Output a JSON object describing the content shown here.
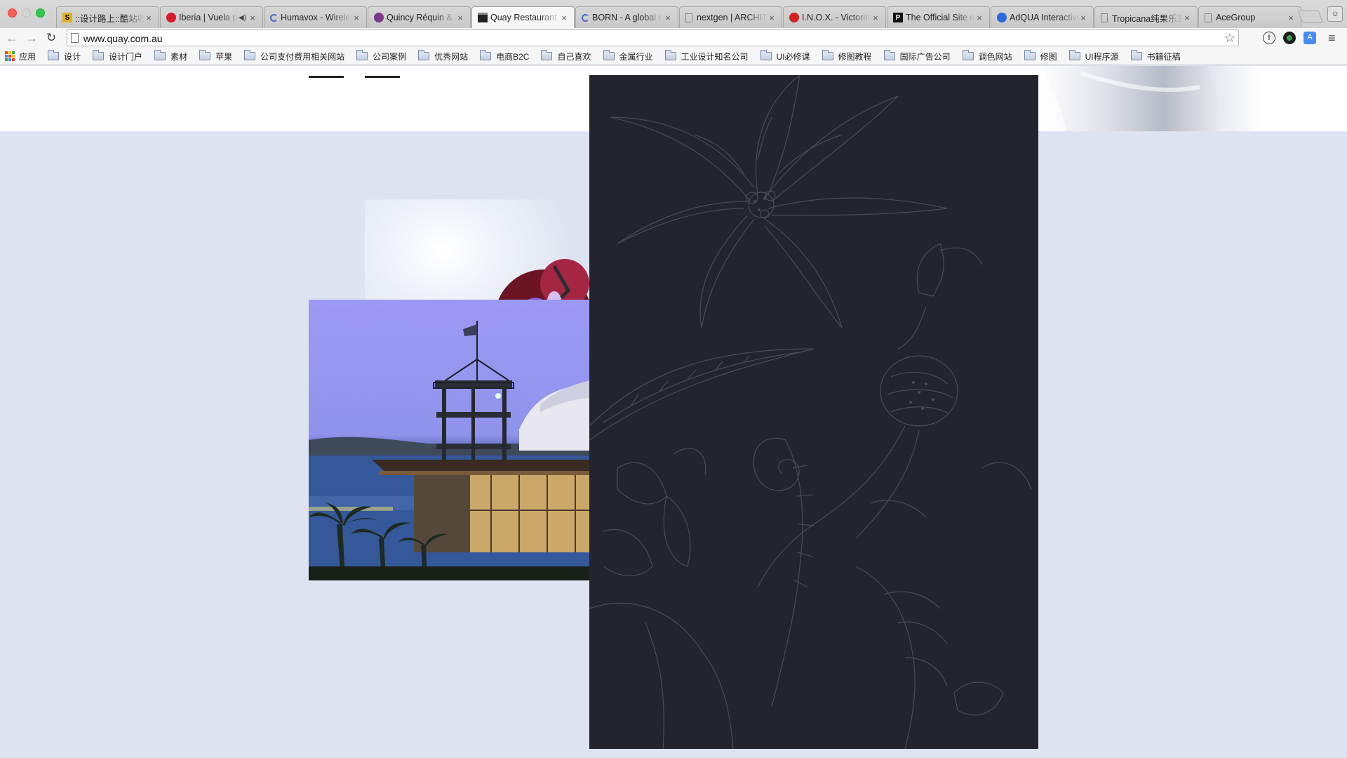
{
  "browser": {
    "tabs": [
      {
        "title": "::设计路上::酷站收藏",
        "favicon": "square-logo-icon",
        "favicon_color": "#e0b020",
        "active": false
      },
      {
        "title": "Iberia | Vuela por el mundo",
        "favicon": "iberia-icon",
        "favicon_color": "#d7192d",
        "active": false,
        "audio": true
      },
      {
        "title": "Humavox - Wireless Charging",
        "favicon": "loading-spinner-icon",
        "favicon_color": "#4a6ac8",
        "active": false
      },
      {
        "title": "Quincy Réquin & Associés",
        "favicon": "spiral-icon",
        "favicon_color": "#7a3a8a",
        "active": false
      },
      {
        "title": "Quay Restaurant",
        "favicon": "quay-icon",
        "favicon_color": "#222222",
        "active": true
      },
      {
        "title": "BORN - A global creative",
        "favicon": "loading-spinner-icon",
        "favicon_color": "#4a6ac8",
        "active": false
      },
      {
        "title": "nextgen | ARCHITECTURE",
        "favicon": "page-icon",
        "favicon_color": "#888888",
        "active": false
      },
      {
        "title": "I.N.O.X. - Victorinox",
        "favicon": "swiss-shield-icon",
        "favicon_color": "#d42020",
        "active": false
      },
      {
        "title": "The Official Site of",
        "favicon": "p-logo-icon",
        "favicon_color": "#111111",
        "active": false
      },
      {
        "title": "AdQUA Interactive",
        "favicon": "adqua-icon",
        "favicon_color": "#2a6ad8",
        "active": false
      },
      {
        "title": "Tropicana纯果乐官网",
        "favicon": "page-icon",
        "favicon_color": "#888888",
        "active": false
      },
      {
        "title": "AceGroup",
        "favicon": "page-icon",
        "favicon_color": "#888888",
        "active": false
      }
    ],
    "tab_close_glyph": "×",
    "url": "www.quay.com.au",
    "bookmarks": [
      {
        "label": "应用",
        "icon": "apps-grid-icon"
      },
      {
        "label": "设计",
        "icon": "folder-icon"
      },
      {
        "label": "设计门户",
        "icon": "folder-icon"
      },
      {
        "label": "素材",
        "icon": "folder-icon"
      },
      {
        "label": "苹果",
        "icon": "folder-icon"
      },
      {
        "label": "公司支付费用相关网站",
        "icon": "folder-icon"
      },
      {
        "label": "公司案例",
        "icon": "folder-icon"
      },
      {
        "label": "优秀网站",
        "icon": "folder-icon"
      },
      {
        "label": "电商B2C",
        "icon": "folder-icon"
      },
      {
        "label": "自己喜欢",
        "icon": "folder-icon"
      },
      {
        "label": "金属行业",
        "icon": "folder-icon"
      },
      {
        "label": "工业设计知名公司",
        "icon": "folder-icon"
      },
      {
        "label": "UI必修课",
        "icon": "folder-icon"
      },
      {
        "label": "修图教程",
        "icon": "folder-icon"
      },
      {
        "label": "国际广告公司",
        "icon": "folder-icon"
      },
      {
        "label": "调色网站",
        "icon": "folder-icon"
      },
      {
        "label": "修图",
        "icon": "folder-icon"
      },
      {
        "label": "UI程序源",
        "icon": "folder-icon"
      },
      {
        "label": "书籍征稿",
        "icon": "folder-icon"
      }
    ]
  },
  "page": {
    "background": "#dde3f0",
    "header_background": "#ffffff",
    "panel_color": "#23242d",
    "illustration_stroke": "#4a4b55"
  }
}
